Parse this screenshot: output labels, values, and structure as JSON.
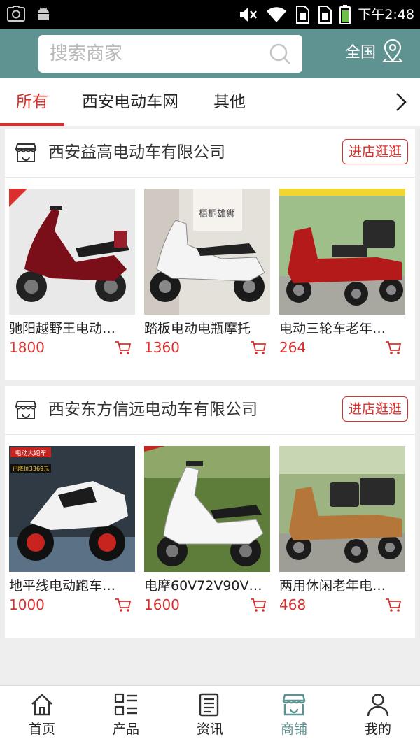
{
  "status_bar": {
    "time": "下午2:48"
  },
  "search": {
    "placeholder": "搜索商家"
  },
  "region": {
    "label": "全国"
  },
  "tabs": [
    {
      "label": "所有",
      "active": true
    },
    {
      "label": "西安电动车网",
      "active": false
    },
    {
      "label": "其他",
      "active": false
    }
  ],
  "stores": [
    {
      "name": "西安益高电动车有限公司",
      "visit_label": "进店逛逛",
      "products": [
        {
          "name": "驰阳越野王电动…",
          "price": "1800"
        },
        {
          "name": "踏板电动电瓶摩托",
          "price": "1360"
        },
        {
          "name": "电动三轮车老年…",
          "price": "264"
        }
      ]
    },
    {
      "name": "西安东方信远电动车有限公司",
      "visit_label": "进店逛逛",
      "products": [
        {
          "name": "地平线电动跑车…",
          "price": "1000"
        },
        {
          "name": "电摩60V72V90V…",
          "price": "1600"
        },
        {
          "name": "两用休闲老年电…",
          "price": "468"
        }
      ]
    }
  ],
  "product_image_text": {
    "showroom_sign": "梧桐雄狮",
    "poster_title": "电动大跑车",
    "poster_price": "已降价3369元"
  },
  "bottom_nav": [
    {
      "label": "首页",
      "icon": "home-icon",
      "active": false
    },
    {
      "label": "产品",
      "icon": "grid-list-icon",
      "active": false
    },
    {
      "label": "资讯",
      "icon": "news-icon",
      "active": false
    },
    {
      "label": "商铺",
      "icon": "shop-icon",
      "active": true
    },
    {
      "label": "我的",
      "icon": "user-icon",
      "active": false
    }
  ],
  "colors": {
    "accent": "#d9302e",
    "brand": "#5f9391",
    "background": "#eeeeee"
  }
}
